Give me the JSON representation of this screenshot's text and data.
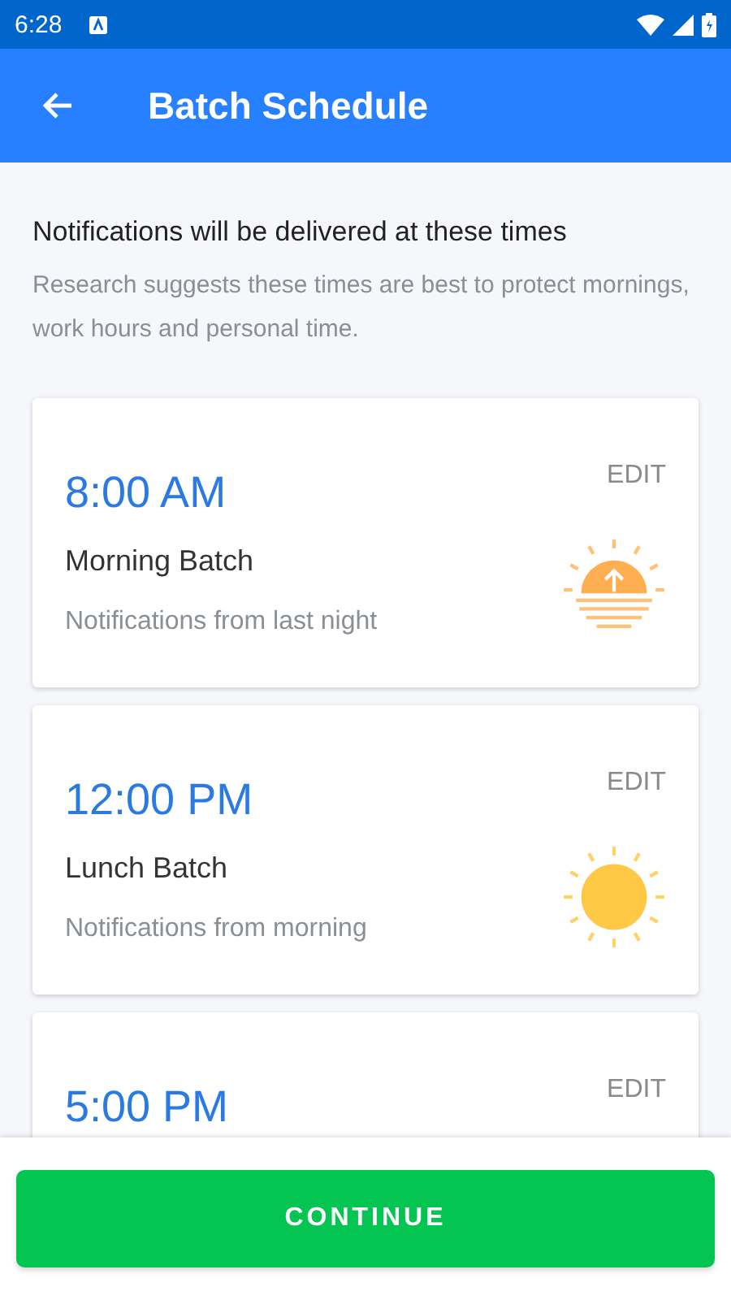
{
  "status_bar": {
    "time": "6:28"
  },
  "app_bar": {
    "title": "Batch Schedule"
  },
  "intro": {
    "heading": "Notifications will be delivered at these times",
    "text": "Research suggests these times are best to protect mornings, work hours and personal time."
  },
  "batches": [
    {
      "time": "8:00 AM",
      "action": "EDIT",
      "title": "Morning Batch",
      "subtitle": "Notifications from last night",
      "kind": "sunrise"
    },
    {
      "time": "12:00 PM",
      "action": "EDIT",
      "title": "Lunch Batch",
      "subtitle": "Notifications from morning",
      "kind": "sun"
    },
    {
      "time": "5:00 PM",
      "action": "EDIT"
    }
  ],
  "footer": {
    "button": "CONTINUE"
  }
}
